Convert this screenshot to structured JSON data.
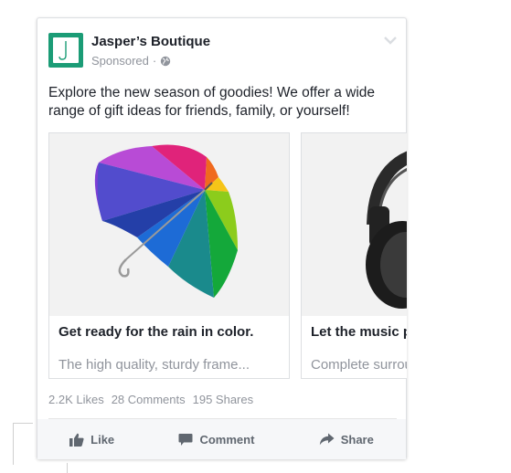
{
  "post": {
    "page_name": "Jasper’s Boutique",
    "sponsored_label": "Sponsored",
    "separator": "·",
    "text": "Explore the new season of goodies! We offer a wide range of gift ideas for friends, family, or yourself!",
    "accent_color": "#1b9c76"
  },
  "carousel": {
    "items": [
      {
        "title": "Get ready for the rain in color.",
        "description": "The high quality, sturdy frame...",
        "image_icon": "umbrella-image"
      },
      {
        "title": "Let the music play l clear.",
        "description": "Complete surround s",
        "image_icon": "headphones-image"
      }
    ]
  },
  "stats": {
    "likes": "2.2K Likes",
    "comments": "28 Comments",
    "shares": "195 Shares"
  },
  "actions": {
    "like": "Like",
    "comment": "Comment",
    "share": "Share"
  }
}
